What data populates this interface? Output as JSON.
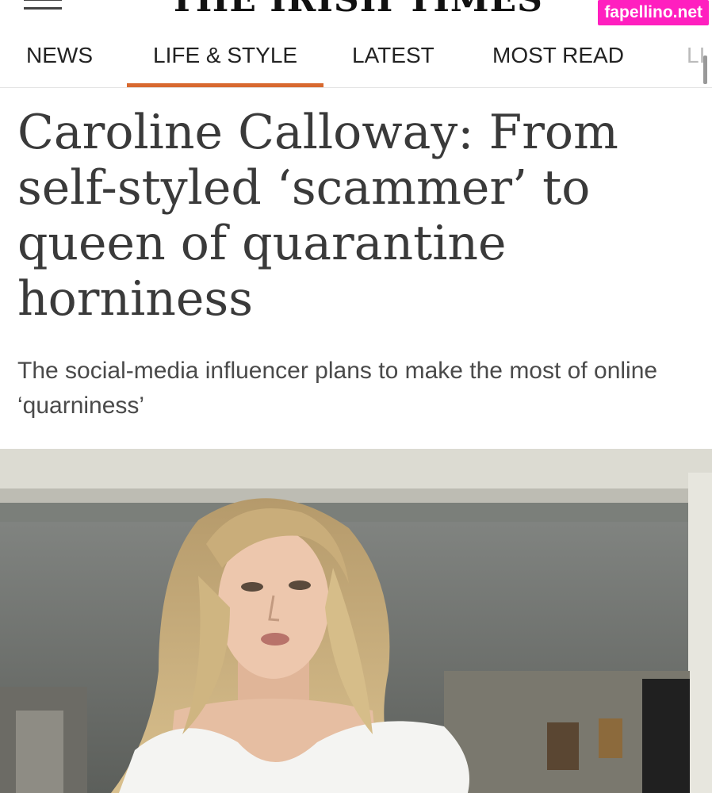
{
  "header": {
    "masthead": "THE IRISH TIMES",
    "menu_icon": "hamburger-menu-icon",
    "watermark": "fapellino.net"
  },
  "nav": {
    "items": [
      {
        "label": "NEWS",
        "active": false
      },
      {
        "label": "LIFE & STYLE",
        "active": true
      },
      {
        "label": "LATEST",
        "active": false
      },
      {
        "label": "MOST READ",
        "active": false
      },
      {
        "label": "LI",
        "active": false
      }
    ],
    "accent": "#d8692f"
  },
  "article": {
    "headline": "Caroline Calloway: From self-styled ‘scammer’ to queen of quarantine horniness",
    "standfirst": "The social-media influencer plans to make the most of online ‘quarniness’",
    "image": "article-photo"
  }
}
